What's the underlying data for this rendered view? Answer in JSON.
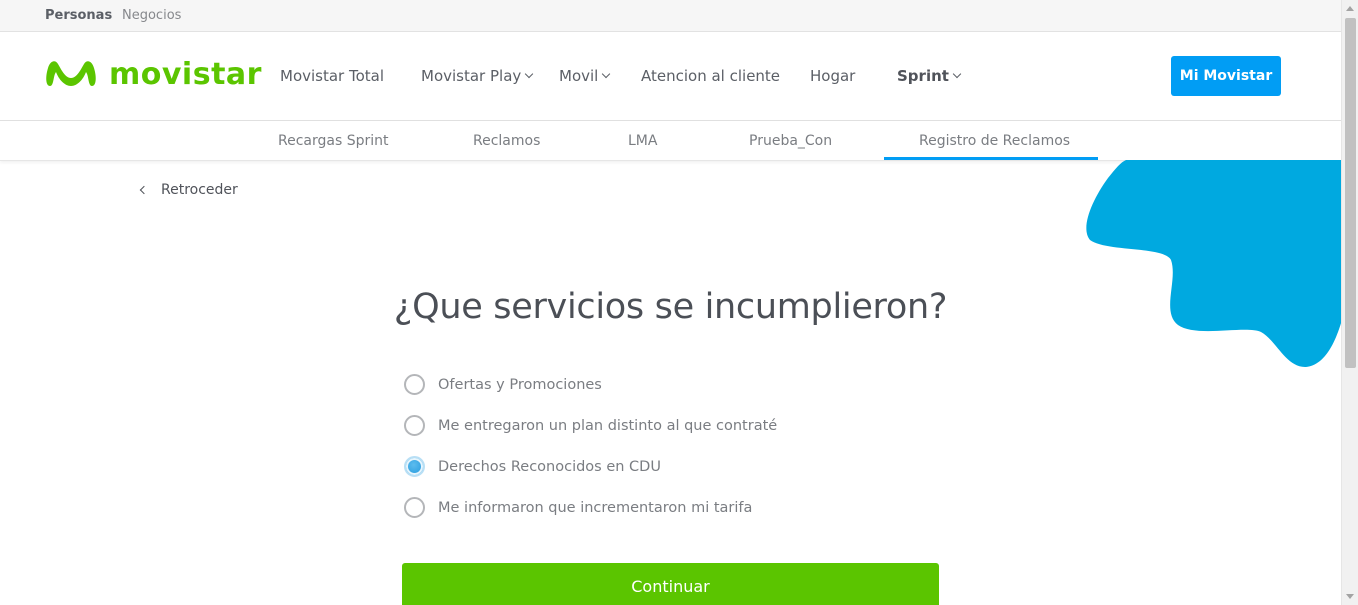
{
  "topbar": {
    "personas": "Personas",
    "negocios": "Negocios"
  },
  "header": {
    "logo_text": "movistar",
    "nav": [
      {
        "label": "Movistar Total",
        "dropdown": false,
        "bold": false
      },
      {
        "label": "Movistar Play",
        "dropdown": true,
        "bold": false
      },
      {
        "label": "Movil",
        "dropdown": true,
        "bold": false
      },
      {
        "label": "Atencion al cliente",
        "dropdown": false,
        "bold": false
      },
      {
        "label": "Hogar",
        "dropdown": false,
        "bold": false
      },
      {
        "label": "Sprint",
        "dropdown": true,
        "bold": true
      }
    ],
    "mi_movistar": "Mi Movistar"
  },
  "subnav": {
    "items": [
      "Recargas Sprint",
      "Reclamos",
      "LMA",
      "Prueba_Con",
      "Registro de Reclamos"
    ],
    "active": "Registro de Reclamos"
  },
  "back_label": "Retroceder",
  "question": "¿Que servicios se incumplieron?",
  "options": [
    {
      "label": "Ofertas y Promociones",
      "checked": false
    },
    {
      "label": "Me entregaron un plan distinto al que contraté",
      "checked": false
    },
    {
      "label": "Derechos Reconocidos en CDU",
      "checked": true
    },
    {
      "label": "Me informaron que incrementaron mi tarifa",
      "checked": false
    }
  ],
  "continue_label": "Continuar",
  "colors": {
    "brand_green": "#5bc500",
    "brand_blue": "#019df4",
    "blob_blue": "#00a9e0"
  },
  "icons": {
    "back": "chevron-left-icon",
    "dropdown": "chevron-down-icon",
    "radio": "radio-icon"
  }
}
